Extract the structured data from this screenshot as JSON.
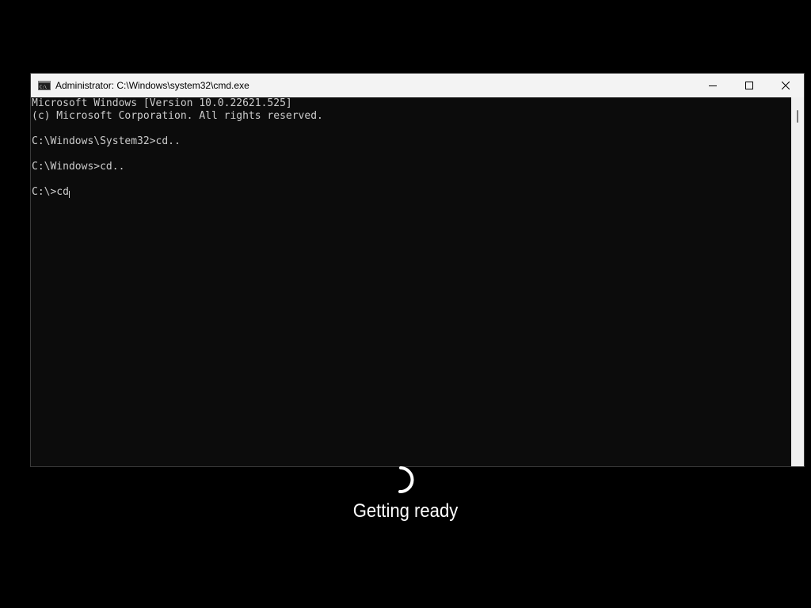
{
  "window": {
    "title": "Administrator: C:\\Windows\\system32\\cmd.exe",
    "icon": "cmd-icon",
    "controls": {
      "minimize": "minimize-icon",
      "maximize": "maximize-icon",
      "close": "close-icon"
    }
  },
  "console": {
    "lines": [
      "Microsoft Windows [Version 10.0.22621.525]",
      "(c) Microsoft Corporation. All rights reserved.",
      "",
      "C:\\Windows\\System32>cd..",
      "",
      "C:\\Windows>cd..",
      ""
    ],
    "current_input": "C:\\>cd"
  },
  "boot_overlay": {
    "status": "Getting ready",
    "spinner": "spinner-icon"
  },
  "colors": {
    "desktop_bg": "#000000",
    "console_bg": "#0c0c0c",
    "console_fg": "#cccccc",
    "titlebar_bg": "#f3f3f3",
    "status_fg": "#ffffff"
  }
}
